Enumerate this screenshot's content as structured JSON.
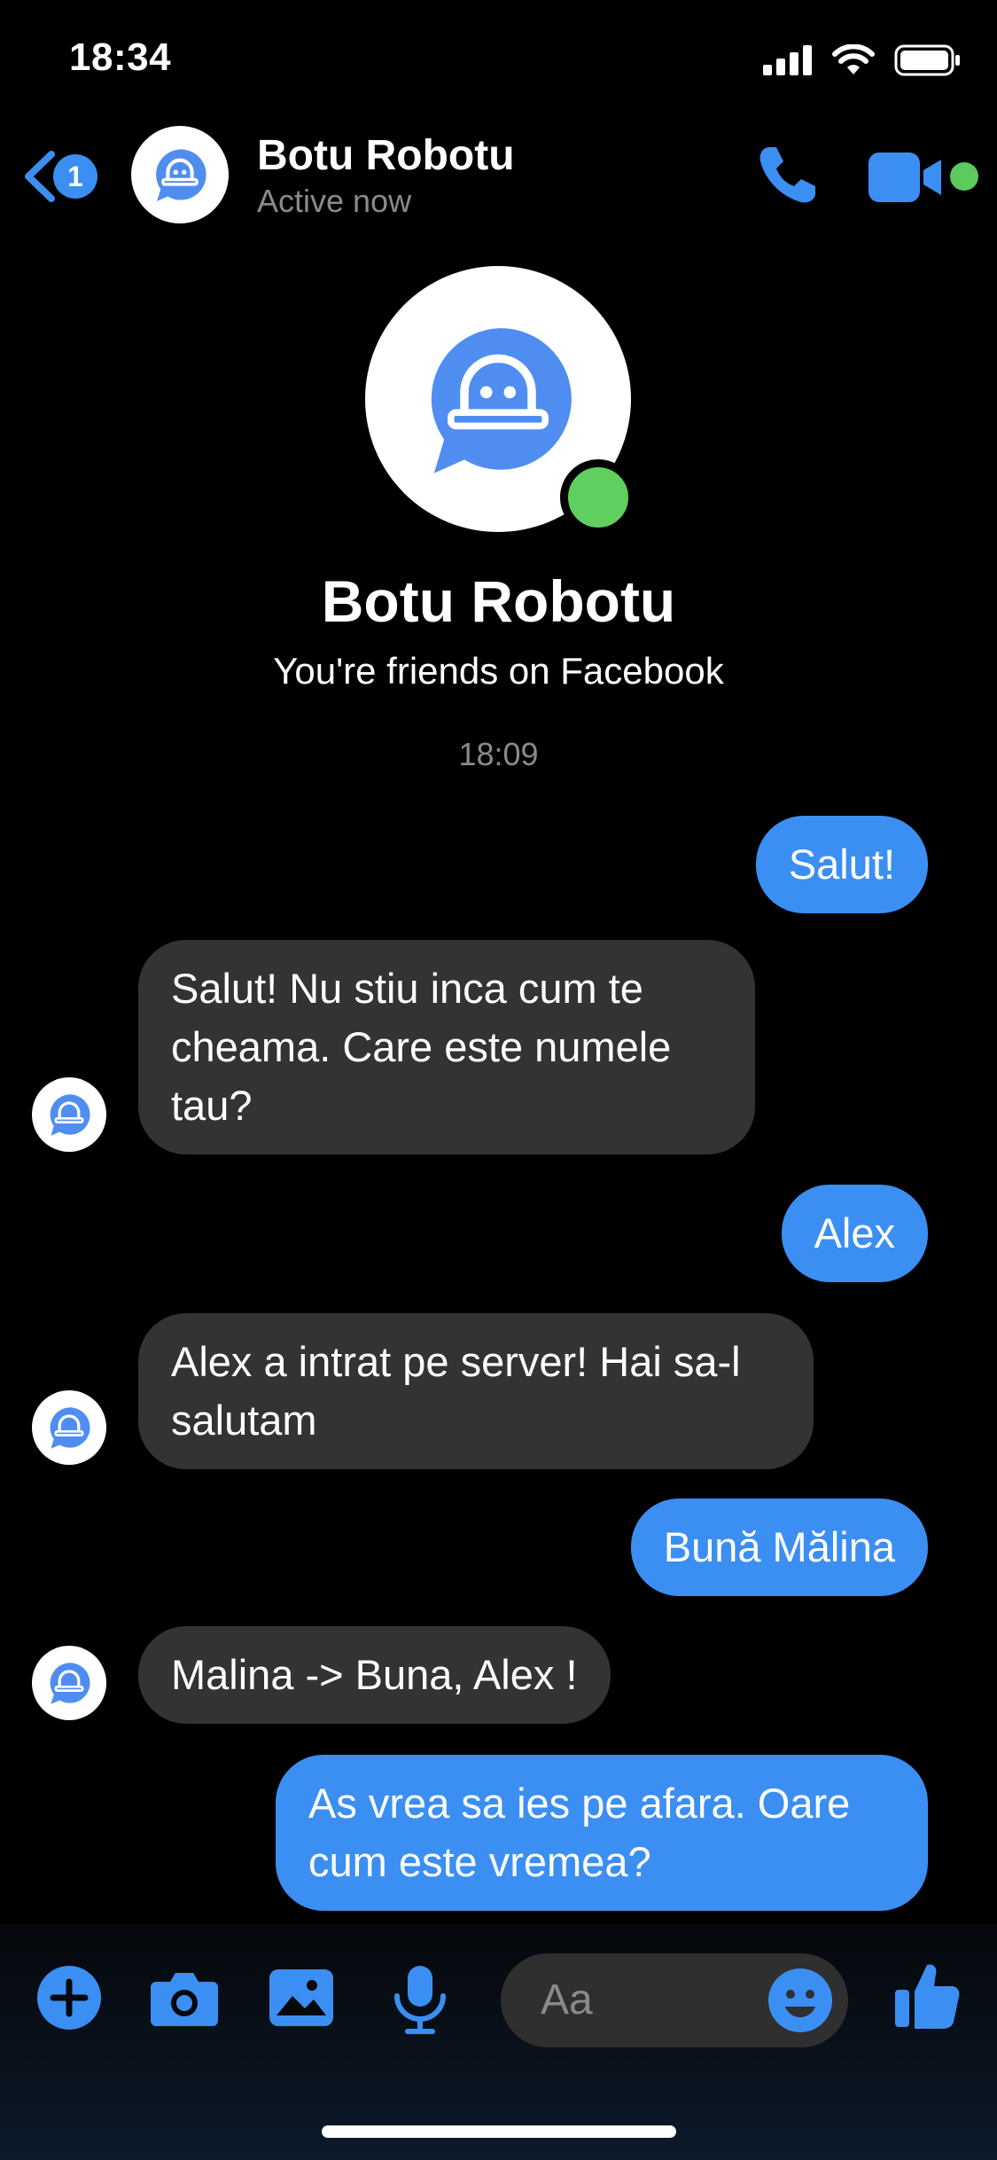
{
  "status_bar": {
    "time": "18:34"
  },
  "header": {
    "back_badge_count": "1",
    "contact_name": "Botu Robotu",
    "contact_status": "Active now"
  },
  "profile": {
    "name": "Botu Robotu",
    "subtitle": "You're friends on Facebook",
    "timestamp": "18:09"
  },
  "messages": [
    {
      "direction": "outgoing",
      "text": "Salut!"
    },
    {
      "direction": "incoming",
      "text": "Salut! Nu stiu inca cum te cheama. Care este numele tau?"
    },
    {
      "direction": "outgoing",
      "text": "Alex"
    },
    {
      "direction": "incoming",
      "text": "Alex a intrat pe server! Hai sa-l salutam"
    },
    {
      "direction": "outgoing",
      "text": "Bună Mălina"
    },
    {
      "direction": "incoming",
      "text": "Malina -> Buna, Alex !"
    },
    {
      "direction": "outgoing",
      "text": "As vrea sa ies pe afara. Oare cum este vremea?"
    }
  ],
  "composer": {
    "placeholder": "Aa",
    "icons": [
      "plus-icon",
      "camera-icon",
      "image-icon",
      "microphone-icon",
      "emoji-icon",
      "thumbs-up-icon"
    ]
  },
  "colors": {
    "accent": "#3b8ff3",
    "incoming_bubble": "#333334",
    "online": "#5cca5c",
    "secondary_text": "#8a8a8e"
  }
}
